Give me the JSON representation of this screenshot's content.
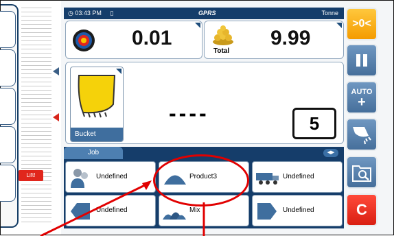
{
  "status": {
    "time": "03:43 PM",
    "network": "GPRS",
    "unit": "Tonne"
  },
  "load": {
    "current_value": "0.01",
    "total_label": "Total",
    "total_value": "9.99"
  },
  "attachment": {
    "label": "Bucket",
    "readout": "----",
    "count": "5"
  },
  "job": {
    "tab_label": "Job",
    "cells": [
      {
        "label": "Undefined",
        "icon": "person-icon"
      },
      {
        "label": "Product3",
        "icon": "product-pile-icon"
      },
      {
        "label": "Undefined",
        "icon": "truck-icon"
      },
      {
        "label": "Undefined",
        "icon": "left-arrow-icon"
      },
      {
        "label": "Mix",
        "icon": "mix-pile-icon"
      },
      {
        "label": "Undefined",
        "icon": "right-arrow-icon"
      }
    ]
  },
  "side_buttons": {
    "zero_label": ">0<",
    "auto_label": "AUTO",
    "auto_plus": "+",
    "clear_label": "C"
  },
  "gauge": {
    "lift_label": "Lift!"
  },
  "colors": {
    "header_navy": "#153d6a",
    "button_blue": "#5b86b3",
    "accent_orange": "#f7a700",
    "alert_red": "#e1261c",
    "annotation_red": "#e10000"
  }
}
